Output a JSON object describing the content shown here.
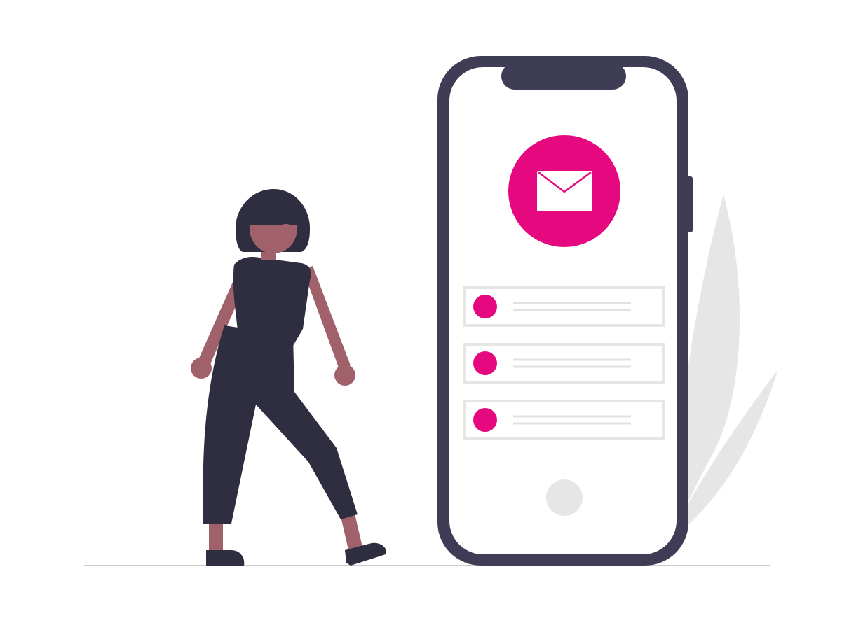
{
  "colors": {
    "background": "#ffffff",
    "phone_frame": "#3f3d56",
    "phone_screen": "#ffffff",
    "accent": "#e6087f",
    "placeholder_gray": "#e6e6e6",
    "line_gray": "#e2e2e2",
    "ground_line": "#cccccc",
    "clothing_dark": "#2f2e41",
    "skin": "#a0616a",
    "envelope": "#ffffff"
  },
  "icons": {
    "hero": "mail-icon",
    "home_button": "home-button-circle",
    "decoration": "leaf-plant-shape"
  },
  "notification_list": {
    "item_count": 3,
    "dot_style": "filled-circle",
    "lines_per_item": 2
  }
}
